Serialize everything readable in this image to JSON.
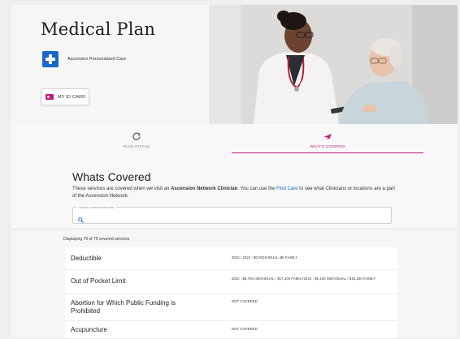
{
  "header": {
    "title": "Medical Plan",
    "brand_name": "Ascension Personalized Care",
    "id_card_label": "MY ID CARD"
  },
  "tabs": [
    {
      "label": "PLAN STATUS",
      "icon": "refresh-icon"
    },
    {
      "label": "WHAT'S COVERED",
      "icon": "plane-icon",
      "active": true
    }
  ],
  "section": {
    "title": "Whats Covered",
    "desc_pre": "These services are covered when we visit an ",
    "desc_bold": "Ascension Network Clinician",
    "desc_mid": ". You can use the ",
    "desc_link": "Find Care",
    "desc_post": " to see what Clinicians or locations are a part of the Ascension Network."
  },
  "search": {
    "legend": "Search covered services",
    "placeholder": ""
  },
  "results": {
    "count_text": "Displaying 79 of 79 covered services",
    "rows": [
      {
        "name": "Deductible",
        "value": "2022 / 2023 : $0 INDIVIDUAL /$0 FAMILY"
      },
      {
        "name": "Out of Pocket Limit",
        "value": "2022 : $8,700 INDIVIDUAL / $17,400 FAMILY2023 : $9,100 INDIVIDUAL / $18,200 FAMILY"
      },
      {
        "name": "Abortion for Which Public Funding is Prohibited",
        "value": "NOT COVERED"
      },
      {
        "name": "Acupuncture",
        "value": "NOT COVERED"
      }
    ]
  },
  "colors": {
    "accent": "#c2187a",
    "brand_blue": "#1a67c9"
  }
}
